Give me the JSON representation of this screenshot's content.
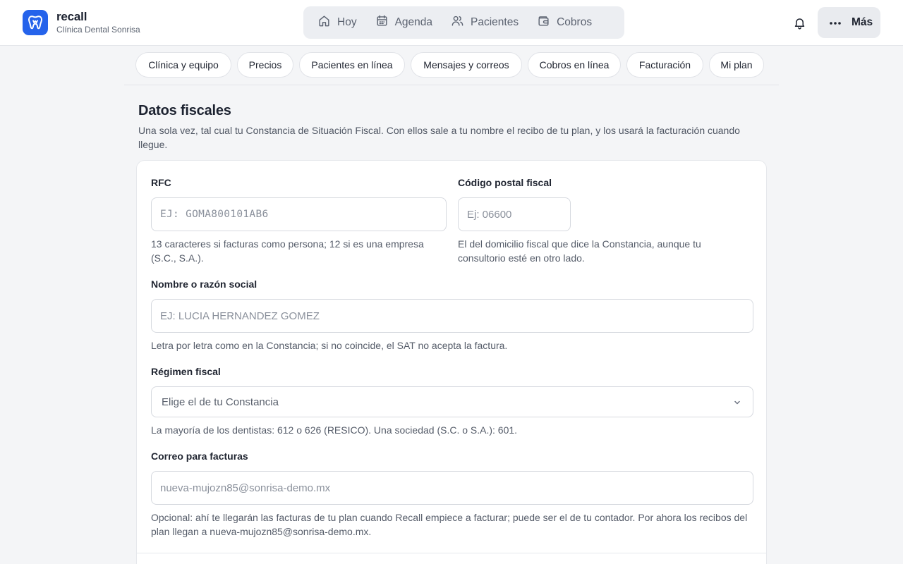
{
  "brand": {
    "name": "recall",
    "subtitle": "Clínica Dental Sonrisa"
  },
  "nav": {
    "items": [
      {
        "label": "Hoy",
        "icon": "home-icon"
      },
      {
        "label": "Agenda",
        "icon": "calendar-icon"
      },
      {
        "label": "Pacientes",
        "icon": "users-icon"
      },
      {
        "label": "Cobros",
        "icon": "wallet-icon"
      }
    ],
    "more_label": "Más"
  },
  "tabs": [
    "Clínica y equipo",
    "Precios",
    "Pacientes en línea",
    "Mensajes y correos",
    "Cobros en línea",
    "Facturación",
    "Mi plan"
  ],
  "section": {
    "title": "Datos fiscales",
    "description": "Una sola vez, tal cual tu Constancia de Situación Fiscal. Con ellos sale a tu nombre el recibo de tu plan, y los usará la facturación cuando llegue."
  },
  "form": {
    "rfc": {
      "label": "RFC",
      "placeholder": "EJ: GOMA800101AB6",
      "value": "",
      "help": "13 caracteres si facturas como persona; 12 si es una empresa (S.C., S.A.)."
    },
    "cp": {
      "label": "Código postal fiscal",
      "placeholder": "Ej: 06600",
      "value": "",
      "help": "El del domicilio fiscal que dice la Constancia, aunque tu consultorio esté en otro lado."
    },
    "razon": {
      "label": "Nombre o razón social",
      "placeholder": "EJ: LUCIA HERNANDEZ GOMEZ",
      "value": "",
      "help": "Letra por letra como en la Constancia; si no coincide, el SAT no acepta la factura."
    },
    "regimen": {
      "label": "Régimen fiscal",
      "selected": "Elige el de tu Constancia",
      "help": "La mayoría de los dentistas: 612 o 626 (RESICO). Una sociedad (S.C. o S.A.): 601."
    },
    "correo": {
      "label": "Correo para facturas",
      "placeholder": "nueva-mujozn85@sonrisa-demo.mx",
      "value": "",
      "help": "Opcional: ahí te llegarán las facturas de tu plan cuando Recall empiece a facturar; puede ser el de tu contador. Por ahora los recibos del plan llegan a nueva-mujozn85@sonrisa-demo.mx."
    }
  },
  "colors": {
    "brand": "#2563eb",
    "background": "#f4f5f7",
    "nav_bg": "#eceef2"
  }
}
